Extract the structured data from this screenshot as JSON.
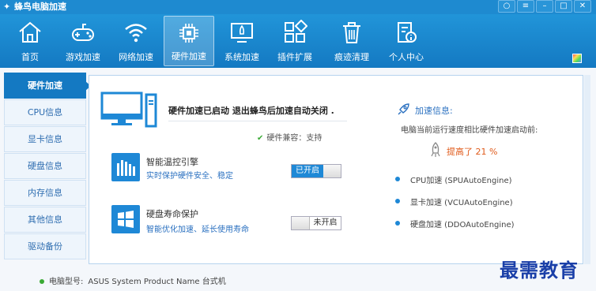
{
  "window": {
    "title": "蜂鸟电脑加速"
  },
  "nav": [
    {
      "label": "首页",
      "icon": "home-icon"
    },
    {
      "label": "游戏加速",
      "icon": "gamepad-icon"
    },
    {
      "label": "网络加速",
      "icon": "wifi-icon"
    },
    {
      "label": "硬件加速",
      "icon": "chip-icon",
      "active": true
    },
    {
      "label": "系统加速",
      "icon": "rocket-screen-icon"
    },
    {
      "label": "插件扩展",
      "icon": "plugin-icon"
    },
    {
      "label": "痕迹清理",
      "icon": "trash-icon"
    },
    {
      "label": "个人中心",
      "icon": "profile-icon"
    }
  ],
  "sidebar": {
    "items": [
      {
        "label": "硬件加速",
        "active": true
      },
      {
        "label": "CPU信息"
      },
      {
        "label": "显卡信息"
      },
      {
        "label": "硬盘信息"
      },
      {
        "label": "内存信息"
      },
      {
        "label": "其他信息"
      },
      {
        "label": "驱动备份"
      }
    ]
  },
  "main": {
    "status": "硬件加速已启动 退出蜂鸟后加速自动关闭 .",
    "compat": "硬件兼容：支持",
    "features": [
      {
        "title": "智能温控引擎",
        "desc": "实时保护硬件安全、稳定",
        "toggle": "已开启",
        "enabled": true
      },
      {
        "title": "硬盘寿命保护",
        "desc": "智能优化加速、延长使用寿命",
        "toggle": "未开启",
        "enabled": false
      }
    ]
  },
  "accel": {
    "title": "加速信息:",
    "desc": "电脑当前运行速度相比硬件加速启动前:",
    "improved": "提高了 21 %",
    "engines": [
      "CPU加速 (SPUAutoEngine)",
      "显卡加速 (VCUAutoEngine)",
      "硬盘加速 (DDOAutoEngine)"
    ]
  },
  "footer": {
    "model_label": "电脑型号:",
    "model_value": "ASUS System Product Name 台式机"
  },
  "watermark": "最需教育",
  "colors": {
    "brand": "#1479c2",
    "accent": "#1e88d6",
    "highlight": "#e05a1a",
    "ok": "#3aaa35"
  }
}
